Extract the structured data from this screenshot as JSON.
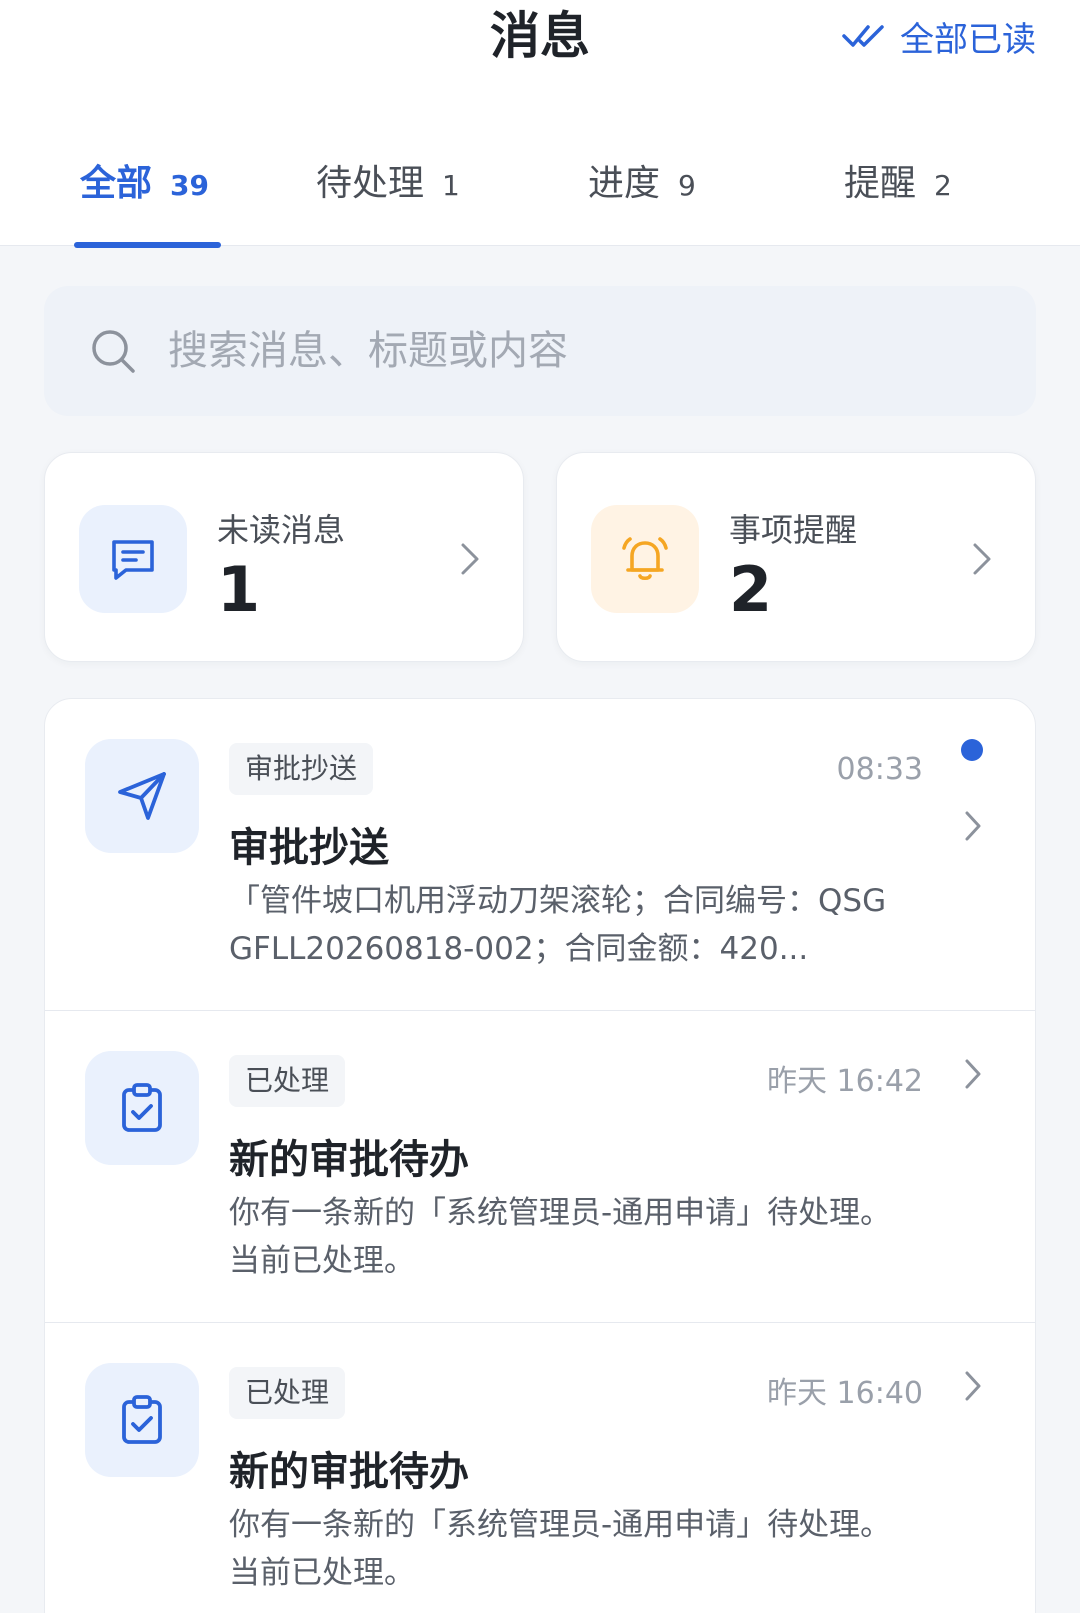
{
  "header": {
    "title": "消息",
    "mark_all_read": "全部已读"
  },
  "tabs": [
    {
      "label": "全部",
      "count": "39",
      "active": true
    },
    {
      "label": "待处理",
      "count": "1",
      "active": false
    },
    {
      "label": "进度",
      "count": "9",
      "active": false
    },
    {
      "label": "提醒",
      "count": "2",
      "active": false
    }
  ],
  "search": {
    "placeholder": "搜索消息、标题或内容",
    "value": ""
  },
  "summary": {
    "unread": {
      "label": "未读消息",
      "value": "1"
    },
    "reminders": {
      "label": "事项提醒",
      "value": "2"
    }
  },
  "messages": [
    {
      "tag": "审批抄送",
      "time": "08:33",
      "title": "审批抄送",
      "body": "「管件坡口机用浮动刀架滚轮；合同编号：QSGGFLL20260818-002；合同金额：420...",
      "unread": true,
      "icon": "send-icon"
    },
    {
      "tag": "已处理",
      "time": "昨天 16:42",
      "title": "新的审批待办",
      "body": "你有一条新的「系统管理员-通用申请」待处理。 当前已处理。",
      "unread": false,
      "icon": "clipboard-check-icon"
    },
    {
      "tag": "已处理",
      "time": "昨天 16:40",
      "title": "新的审批待办",
      "body": "你有一条新的「系统管理员-通用申请」待处理。 当前已处理。",
      "unread": false,
      "icon": "clipboard-check-icon"
    }
  ],
  "colors": {
    "accent": "#2b63d9",
    "reminder_icon": "#f5a623",
    "background": "#f4f6f9"
  }
}
